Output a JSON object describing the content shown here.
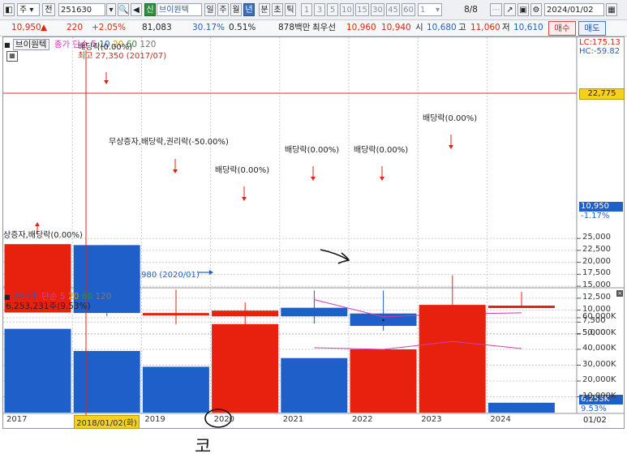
{
  "toolbar": {
    "market_label": "주",
    "view_label": "전",
    "code": "251630",
    "badge": "신",
    "stock_name": "브이원텍",
    "period_tabs": [
      "일",
      "주",
      "월",
      "년",
      "분",
      "초",
      "틱"
    ],
    "active_period": "년",
    "interval_buttons": [
      "1",
      "3",
      "5",
      "10",
      "15",
      "30",
      "45",
      "60"
    ],
    "count_value": "1",
    "page_indicator": "8/8",
    "date_value": "2024/01/02"
  },
  "quote": {
    "price": "10,950",
    "arrow": "▲",
    "change": "220",
    "change_pct": "+2.05%",
    "volume": "81,083",
    "turnover_pct": "30.17%",
    "ratio_pct": "0.51%",
    "amount": "878백만",
    "best_ask_label": "최우선",
    "best_ask": "10,960",
    "best_bid": "10,940",
    "open_label": "시",
    "open": "10,680",
    "high_label": "고",
    "high": "11,060",
    "low_label": "저",
    "low": "10,610",
    "buy_label": "매수",
    "sell_label": "매도"
  },
  "price_panel": {
    "name": "브이원텍",
    "ma_label": "종가 단순",
    "ma_periods": [
      "5",
      "10",
      "20",
      "60",
      "120"
    ],
    "lc": "LC:175.13",
    "hc": "HC:-59.82",
    "high_note": "최고 27,350 (2017/07)",
    "low_note": "최저 3,980 (2020/01)",
    "current_price_tag": "22,775",
    "last_price_tag": "10,950",
    "last_pct_tag": "-1.17%"
  },
  "volume_panel": {
    "name": "거래량",
    "ma_label": "단순",
    "ma_periods": [
      "5",
      "20",
      "60",
      "120"
    ],
    "current_text": "6,253,231주(9.53%)",
    "last_tag": "6,253K",
    "last_pct": "9.53%"
  },
  "events": [
    {
      "year": "2018",
      "label": "배당락(0.00%)"
    },
    {
      "year": "2019",
      "label": "무상증자,배당락,권리락(-50.00%)"
    },
    {
      "year": "2020",
      "label": "배당락(0.00%)"
    },
    {
      "year": "2021",
      "label": "배당락(0.00%)"
    },
    {
      "year": "2022",
      "label": "배당락(0.00%)"
    },
    {
      "year": "2023",
      "label": "배당락(0.00%)"
    },
    {
      "year": "2017",
      "label": "상증자,배당락(0.00%)"
    }
  ],
  "x_axis": {
    "labels": [
      "2017",
      "2018/01/02(화)",
      "2019",
      "2020",
      "2021",
      "2022",
      "2023",
      "2024"
    ],
    "right_label": "01/02"
  },
  "annotation": {
    "handwritten_text": "코"
  },
  "colors": {
    "up": "#e8210f",
    "down": "#1f5fc9",
    "ma": "#d23bb2",
    "grid": "#c9cdd3",
    "cursor": "#c93a3a"
  },
  "chart_data": [
    {
      "type": "candlestick",
      "title": "브이원텍",
      "x": [
        "2017",
        "2018",
        "2019",
        "2020",
        "2021",
        "2022",
        "2023",
        "2024"
      ],
      "open": [
        9500,
        23600,
        9100,
        8700,
        10500,
        9300,
        6000,
        10700
      ],
      "close": [
        23800,
        9400,
        9400,
        9900,
        8700,
        6700,
        11100,
        10950
      ],
      "high": [
        23800,
        23600,
        14300,
        11600,
        14100,
        14100,
        17300,
        13800
      ],
      "low": [
        9500,
        8700,
        7000,
        3980,
        7200,
        5700,
        6000,
        10500
      ],
      "ma5": {
        "x": [
          "2021",
          "2022",
          "2023",
          "2024"
        ],
        "values": [
          12200,
          8600,
          9200,
          9450
        ]
      },
      "yticks": [
        5000,
        7500,
        10000,
        12500,
        15000,
        17500,
        20000,
        22500,
        25000
      ],
      "ylim": [
        3000,
        27500
      ]
    },
    {
      "type": "bar",
      "title": "거래량",
      "x": [
        "2017",
        "2018",
        "2019",
        "2020",
        "2021",
        "2022",
        "2023",
        "2024"
      ],
      "values": [
        53000,
        39000,
        29000,
        56000,
        34500,
        40000,
        65000,
        6253
      ],
      "up": [
        false,
        false,
        false,
        true,
        false,
        true,
        true,
        false
      ],
      "ma5": {
        "x": [
          "2021",
          "2022",
          "2023",
          "2024"
        ],
        "values": [
          41000,
          40000,
          45000,
          40500
        ]
      },
      "yticks": [
        10000,
        20000,
        30000,
        40000,
        50000,
        60000
      ],
      "ytick_labels": [
        "10,000K",
        "20,000K",
        "30,000K",
        "40,000K",
        "50,000K",
        "60,000K"
      ],
      "ylim": [
        0,
        70000
      ]
    }
  ]
}
